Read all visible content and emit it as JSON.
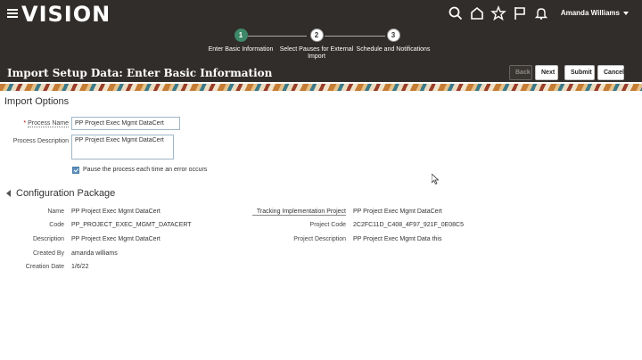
{
  "header": {
    "logo": "VISION",
    "user_name": "Amanda Williams"
  },
  "train": {
    "steps": [
      {
        "number": "1",
        "label": "Enter Basic Information"
      },
      {
        "number": "2",
        "label": "Select Pauses for External Import"
      },
      {
        "number": "3",
        "label": "Schedule and Notifications"
      }
    ]
  },
  "title_bar": {
    "title": "Import Setup Data: Enter Basic Information",
    "back_label": "Back",
    "next_label": "Next",
    "submit_label": "Submit",
    "cancel_label": "Cancel"
  },
  "import_options": {
    "section_title": "Import Options",
    "process_name_label": "Process Name",
    "process_name_value": "PP Project Exec Mgmt DataCert",
    "process_description_label": "Process Description",
    "process_description_value": "PP Project Exec Mgmt DataCert",
    "pause_checkbox_label": "Pause the process each time an error occurs"
  },
  "config_package": {
    "section_title": "Configuration Package",
    "name_label": "Name",
    "name_value": "PP Project Exec Mgmt DataCert",
    "code_label": "Code",
    "code_value": "PP_PROJECT_EXEC_MGMT_DATACERT",
    "description_label": "Description",
    "description_value": "PP Project Exec Mgmt DataCert",
    "created_by_label": "Created By",
    "created_by_value": "amanda williams",
    "creation_date_label": "Creation Date",
    "creation_date_value": "1/6/22",
    "tracking_project_label": "Tracking Implementation Project",
    "tracking_project_value": "PP Project Exec Mgmt DataCert",
    "project_code_label": "Project Code",
    "project_code_value": "2C2FC11D_C408_4F97_921F_0E08C5",
    "project_description_label": "Project Description",
    "project_description_value": "PP Project Exec Mgmt Data this"
  }
}
